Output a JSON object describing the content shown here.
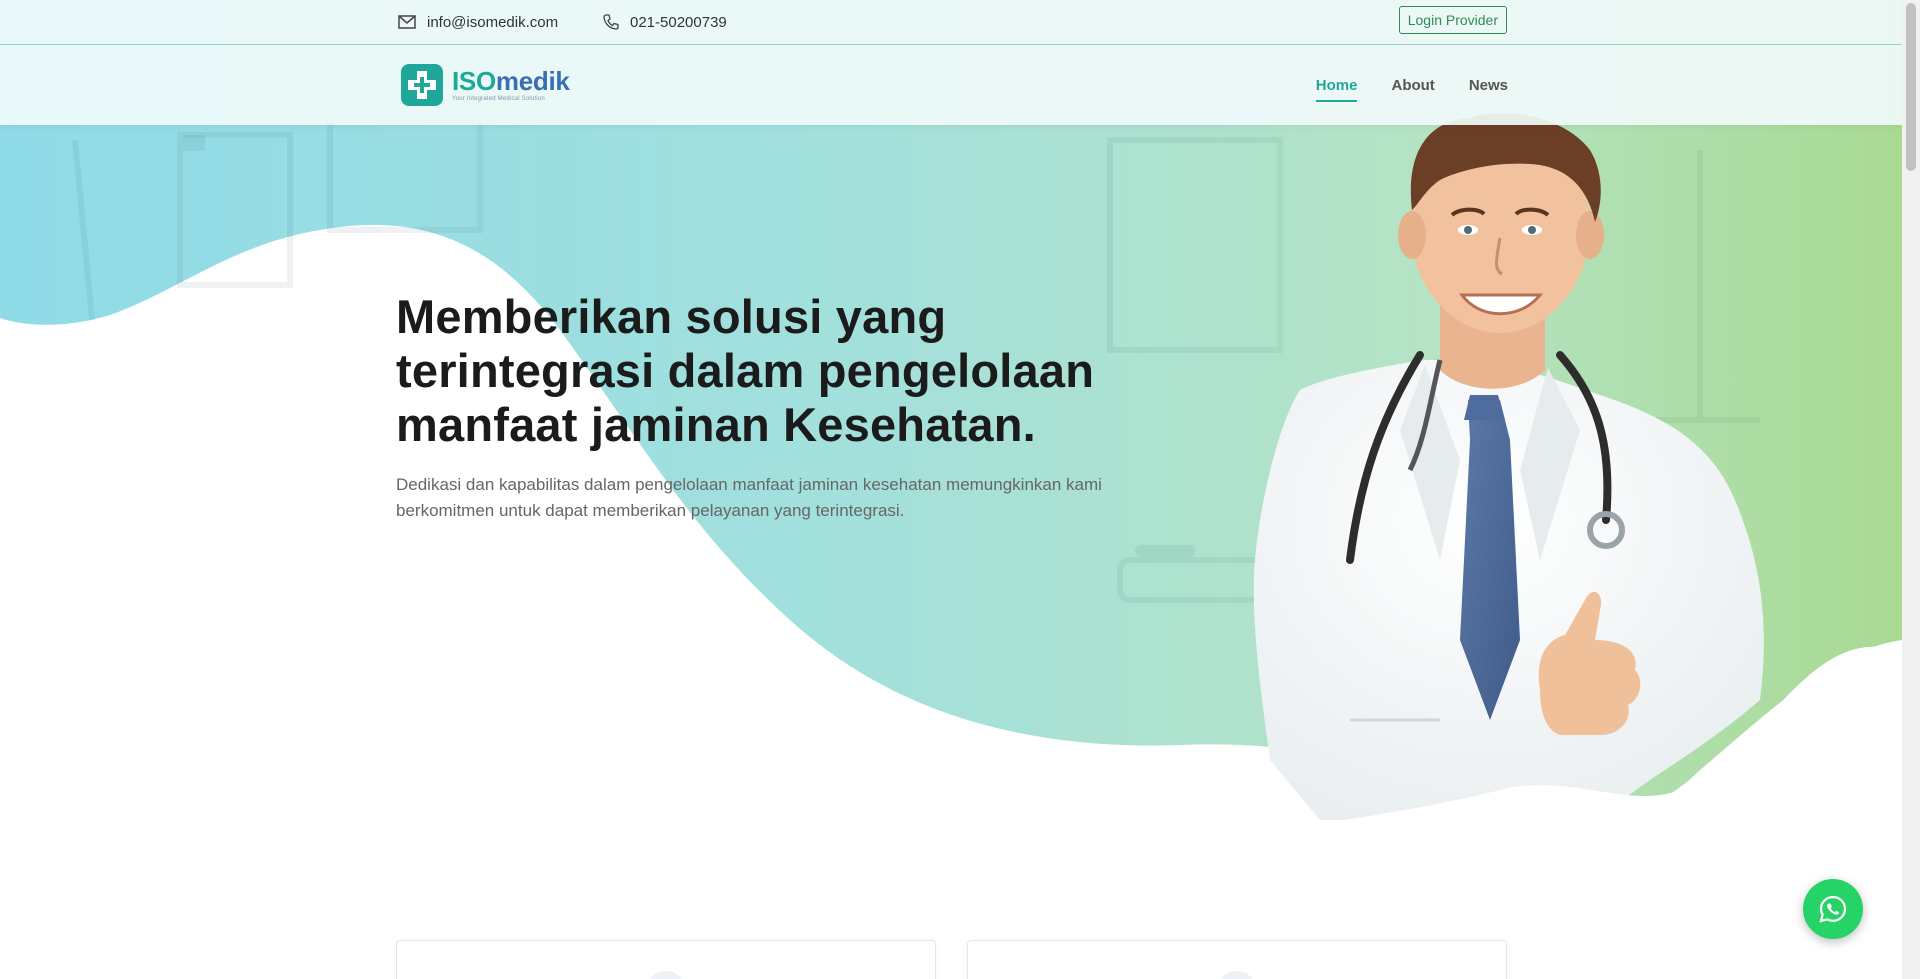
{
  "topbar": {
    "email": "info@isomedik.com",
    "phone": "021-50200739",
    "login_label": "Login Provider",
    "email_icon": "mail-icon",
    "phone_icon": "phone-icon"
  },
  "brand": {
    "name_iso": "ISO",
    "name_medik": "medik",
    "tagline": "Your Integrated Medical Solution",
    "primary_color": "#1fa89a",
    "secondary_color": "#3a6fb0"
  },
  "nav": {
    "items": [
      {
        "label": "Home",
        "active": true
      },
      {
        "label": "About",
        "active": false
      },
      {
        "label": "News",
        "active": false
      }
    ]
  },
  "hero": {
    "title": "Memberikan solusi yang terintegrasi dalam pengelolaan manfaat jaminan Kesehatan.",
    "subtitle": "Dedikasi dan kapabilitas dalam pengelolaan manfaat jaminan kesehatan memungkinkan kami berkomitmen untuk dapat memberikan pelayanan yang terintegrasi.",
    "image": "smiling-doctor-thumbs-up",
    "gradient_colors": [
      "#8fdbe6",
      "#a6e0dc",
      "#b9e3bd",
      "#a8d88f"
    ]
  },
  "floating": {
    "whatsapp_icon": "whatsapp-icon",
    "whatsapp_color": "#25d366"
  }
}
